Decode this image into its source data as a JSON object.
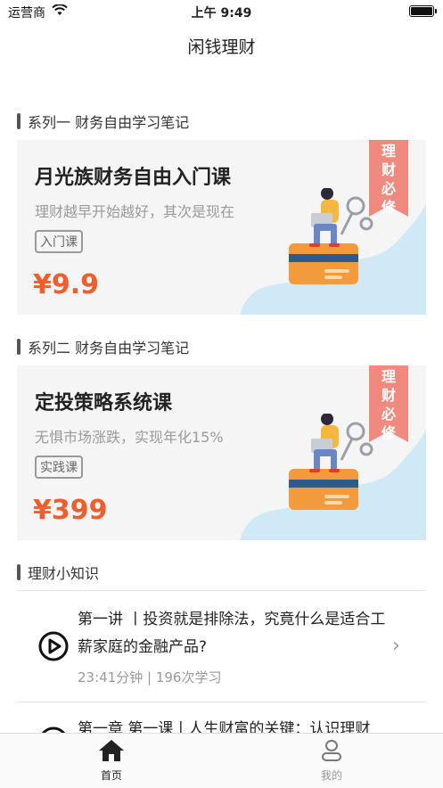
{
  "status_bar": {
    "carrier": "运营商",
    "time": "上午 9:49"
  },
  "nav": {
    "title": "闲钱理财"
  },
  "sections": [
    {
      "title": "系列一 财务自由学习笔记"
    },
    {
      "title": "系列二 财务自由学习笔记"
    },
    {
      "title": "理财小知识"
    }
  ],
  "courses": [
    {
      "title": "月光族财务自由入门课",
      "subtitle": "理财越早开始越好，其次是现在",
      "tag": "入门课",
      "price": "¥9.9",
      "ribbon": "理财必修"
    },
    {
      "title": "定投策略系统课",
      "subtitle": "无惧市场涨跌，实现年化15%",
      "tag": "实践课",
      "price": "¥399",
      "ribbon": "理财必修"
    }
  ],
  "lessons": [
    {
      "title": "第一讲 丨投资就是排除法，究竟什么是适合工薪家庭的金融产品?",
      "meta": "23:41分钟 | 196次学习"
    },
    {
      "title": "第一章 第一课丨人生财富的关键：认识理财"
    }
  ],
  "tabs": [
    {
      "label": "首页",
      "icon": "home-icon",
      "active": true
    },
    {
      "label": "我的",
      "icon": "profile-icon",
      "active": false
    }
  ],
  "colors": {
    "price": "#ef5f2e",
    "ribbon": "#f08a7e",
    "blob": "#cfe9f7",
    "tab_active": "#222222",
    "tab_inactive": "#999999"
  }
}
